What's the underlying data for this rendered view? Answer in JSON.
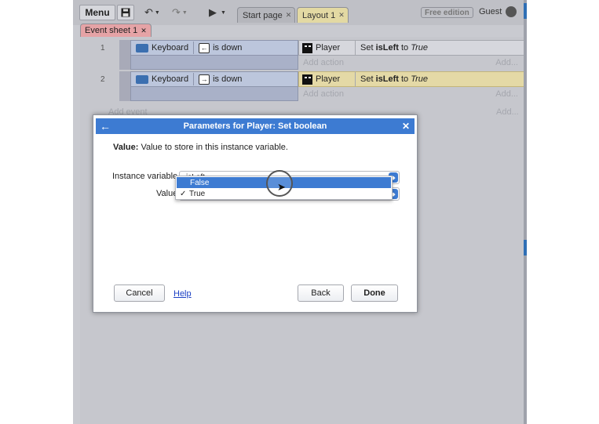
{
  "toolbar": {
    "menu_label": "Menu",
    "save_icon": "save-icon",
    "undo_icon": "undo-icon",
    "redo_icon": "redo-icon",
    "play_icon": "play-icon",
    "tabs": [
      {
        "label": "Start page",
        "active": false
      },
      {
        "label": "Layout 1",
        "active": true
      }
    ],
    "badge": "Free edition",
    "user": "Guest"
  },
  "sheet_tab": {
    "label": "Event sheet 1"
  },
  "events": [
    {
      "number": "1",
      "object": "Keyboard",
      "key": "←",
      "condition": "is down",
      "action_object": "Player",
      "action_prefix": "Set",
      "action_var": "isLeft",
      "action_mid": "to",
      "action_value": "True",
      "add_action": "Add action",
      "add": "Add..."
    },
    {
      "number": "2",
      "object": "Keyboard",
      "key": "→",
      "condition": "is down",
      "action_object": "Player",
      "action_prefix": "Set",
      "action_var": "isLeft",
      "action_mid": "to",
      "action_value": "True",
      "add_action": "Add action",
      "add": "Add..."
    }
  ],
  "add_event": {
    "label": "Add event",
    "add": "Add..."
  },
  "dialog": {
    "title": "Parameters for Player: Set boolean",
    "desc_label": "Value:",
    "desc_text": "Value to store in this instance variable.",
    "instance_var_label": "Instance variable",
    "instance_var_value": "isLeft",
    "value_label": "Value",
    "dropdown_options": [
      {
        "label": "False",
        "selected": true,
        "checked": false
      },
      {
        "label": "True",
        "selected": false,
        "checked": true
      }
    ],
    "cancel": "Cancel",
    "help": "Help",
    "back": "Back",
    "done": "Done"
  },
  "colors": {
    "accent": "#3d7bd2",
    "highlight_row": "#e4d9a6",
    "sheet_tab": "#e5a3a6"
  }
}
